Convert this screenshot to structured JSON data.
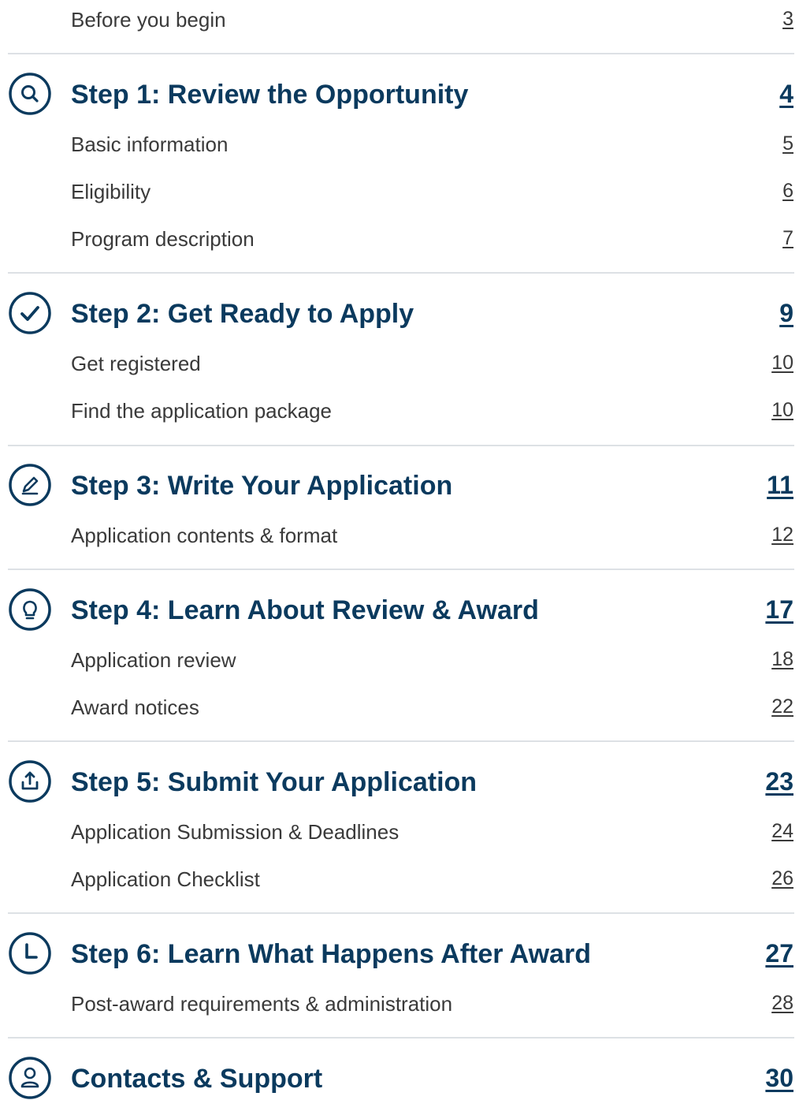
{
  "toc": {
    "intro": {
      "label": "Before you begin",
      "page": "3"
    },
    "steps": [
      {
        "title": "Step 1: Review the Opportunity",
        "page": "4",
        "icon": "search-icon",
        "items": [
          {
            "label": "Basic information",
            "page": "5"
          },
          {
            "label": "Eligibility",
            "page": "6"
          },
          {
            "label": "Program description",
            "page": "7"
          }
        ]
      },
      {
        "title": "Step 2: Get Ready to Apply",
        "page": "9",
        "icon": "checkmark-icon",
        "items": [
          {
            "label": "Get registered",
            "page": "10"
          },
          {
            "label": "Find the application package",
            "page": "10"
          }
        ]
      },
      {
        "title": "Step 3: Write Your Application",
        "page": "11",
        "icon": "pencil-icon",
        "items": [
          {
            "label": "Application contents & format",
            "page": "12"
          }
        ]
      },
      {
        "title": "Step 4: Learn About Review & Award",
        "page": "17",
        "icon": "lightbulb-icon",
        "items": [
          {
            "label": "Application review",
            "page": "18"
          },
          {
            "label": "Award notices",
            "page": "22"
          }
        ]
      },
      {
        "title": "Step 5: Submit Your Application",
        "page": "23",
        "icon": "upload-icon",
        "items": [
          {
            "label": "Application Submission & Deadlines",
            "page": "24"
          },
          {
            "label": "Application Checklist",
            "page": "26"
          }
        ]
      },
      {
        "title": "Step 6: Learn What Happens After Award",
        "page": "27",
        "icon": "clock-icon",
        "items": [
          {
            "label": "Post-award requirements & administration",
            "page": "28"
          }
        ]
      },
      {
        "title": "Contacts & Support",
        "page": "30",
        "icon": "person-icon",
        "items": []
      }
    ]
  }
}
